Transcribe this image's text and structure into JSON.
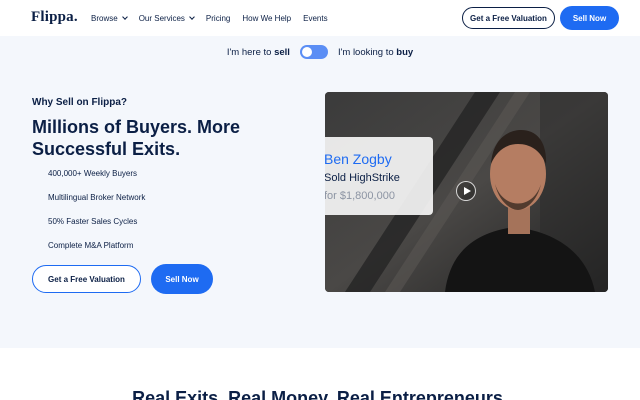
{
  "header": {
    "logo": "Flippa.",
    "nav": [
      {
        "label": "Browse",
        "has_dropdown": true
      },
      {
        "label": "Our Services",
        "has_dropdown": true
      },
      {
        "label": "Pricing",
        "has_dropdown": false
      },
      {
        "label": "How We Help",
        "has_dropdown": false
      },
      {
        "label": "Events",
        "has_dropdown": false
      }
    ],
    "valuation_button": "Get a Free Valuation",
    "sell_button": "Sell Now"
  },
  "toggle": {
    "left_prefix": "I'm here to",
    "left_bold": "sell",
    "right_prefix": "I'm looking to",
    "right_bold": "buy",
    "state": "sell"
  },
  "hero": {
    "eyebrow": "Why Sell on Flippa?",
    "headline": "Millions of Buyers. More Successful Exits.",
    "features": [
      "400,000+ Weekly Buyers",
      "Multilingual Broker Network",
      "50% Faster Sales Cycles",
      "Complete M&A Platform"
    ],
    "valuation_button": "Get a Free Valuation",
    "sell_button": "Sell Now"
  },
  "video": {
    "name": "Ben Zogby",
    "sold_line": "Sold HighStrike",
    "price_line": "for $1,800,000"
  },
  "lower": {
    "title": "Real Exits. Real Money. Real Entrepreneurs."
  },
  "colors": {
    "brand_blue": "#1e6bf2",
    "navy": "#0b1f45",
    "hero_bg": "#f4f7fc"
  }
}
